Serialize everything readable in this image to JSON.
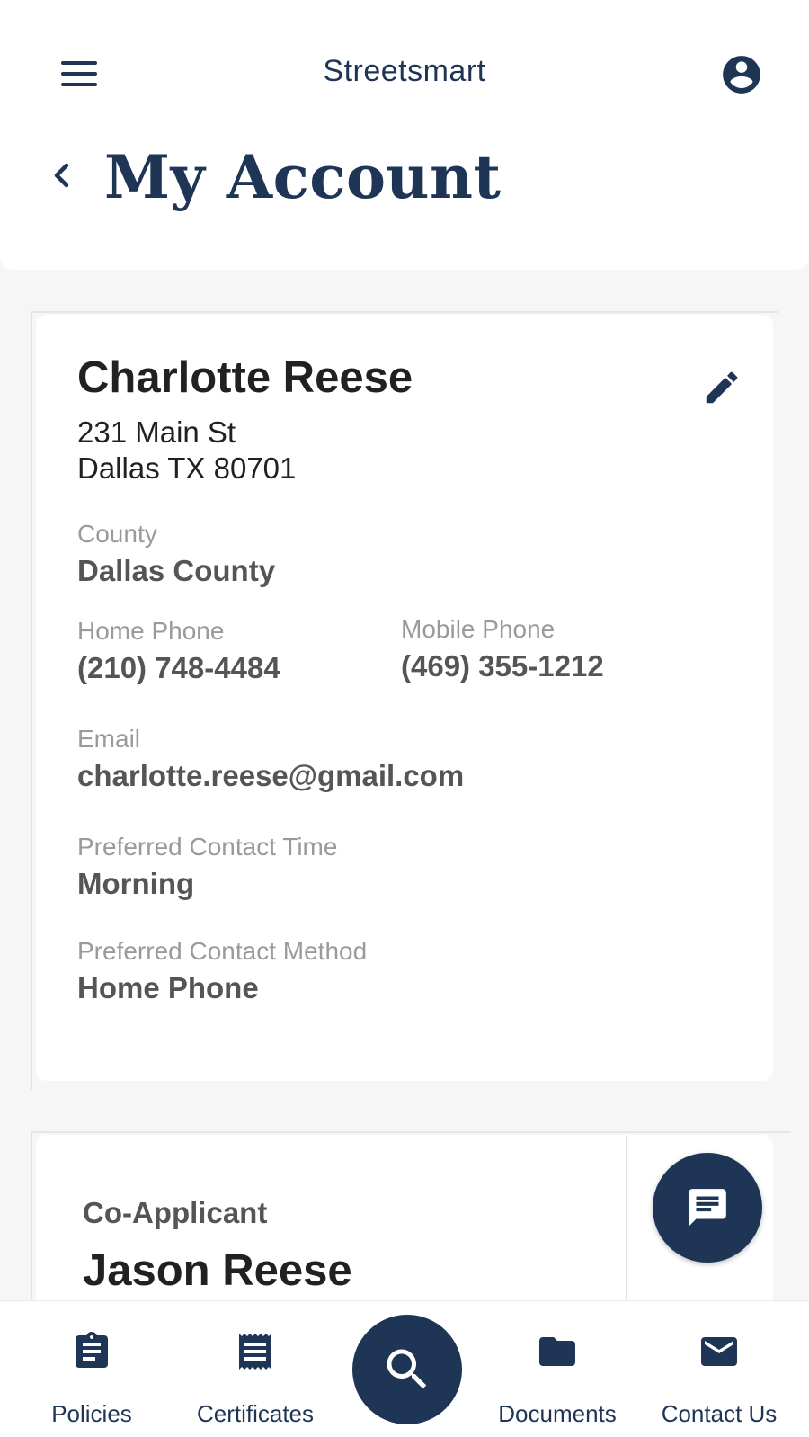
{
  "header": {
    "app_title": "Streetsmart",
    "page_title": "My Account"
  },
  "account": {
    "name": "Charlotte Reese",
    "address_line1": "231 Main St",
    "address_line2": "Dallas TX 80701",
    "county_label": "County",
    "county_value": "Dallas County",
    "home_phone_label": "Home Phone",
    "home_phone_value": "(210) 748-4484",
    "mobile_phone_label": "Mobile Phone",
    "mobile_phone_value": "(469) 355-1212",
    "email_label": "Email",
    "email_value": "charlotte.reese@gmail.com",
    "contact_time_label": "Preferred Contact Time",
    "contact_time_value": "Morning",
    "contact_method_label": "Preferred Contact Method",
    "contact_method_value": "Home Phone"
  },
  "co_applicant": {
    "label": "Co-Applicant",
    "name": "Jason Reese"
  },
  "bottom_nav": {
    "items": [
      {
        "label": "Policies",
        "icon": "clipboard-icon"
      },
      {
        "label": "Certificates",
        "icon": "receipt-icon"
      },
      {
        "label": "",
        "icon": "search-icon"
      },
      {
        "label": "Documents",
        "icon": "folder-icon"
      },
      {
        "label": "Contact Us",
        "icon": "mail-icon"
      }
    ]
  },
  "colors": {
    "brand": "#1f3556",
    "background": "#f6f6f6",
    "label_gray": "#9a9a9a",
    "value_gray": "#555555"
  }
}
